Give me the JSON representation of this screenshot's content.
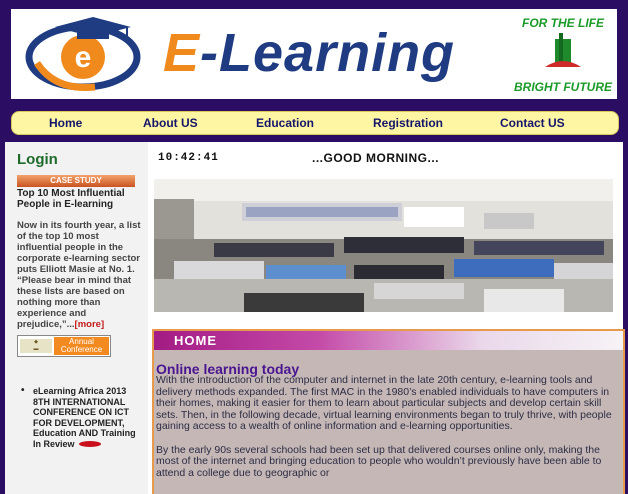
{
  "header": {
    "logo_letter": "e",
    "logo_e": "E",
    "logo_rest": "-Learning",
    "badge_top": "FOR THE LIFE",
    "badge_bottom": "BRIGHT FUTURE"
  },
  "nav": {
    "items": [
      {
        "label": "Home"
      },
      {
        "label": "About US"
      },
      {
        "label": "Education"
      },
      {
        "label": "Registration"
      },
      {
        "label": "Contact US"
      }
    ]
  },
  "sidebar": {
    "login_heading": "Login",
    "case_study_label": "CASE STUDY",
    "case_title": "Top 10 Most Influential People in E-learning",
    "case_body": "Now in its fourth year, a list of the top 10 most influential people in the corporate e-learning sector puts Elliott Masie at No. 1. “Please bear in mind that these lists are based on nothing more than experience and prejudice,”...",
    "more_link": "[more]",
    "conference_line1": "Annual",
    "conference_line2": "Conference",
    "news_items": [
      {
        "text": "eLearning Africa 2013 8TH INTERNATIONAL CONFERENCE ON ICT FOR DEVELOPMENT, Education AND Training In Review"
      }
    ]
  },
  "main": {
    "clock": "10:42:41",
    "greeting": "...GOOD MORNING...",
    "section_title": "HOME",
    "article_title": "Online learning today",
    "paragraphs": [
      "With the introduction of the computer and internet in the late 20th century, e-learning tools and delivery methods expanded. The first MAC in the 1980’s enabled individuals to have computers in their homes, making it easier for them to learn about particular subjects and develop certain skill sets. Then, in the following decade, virtual learning environments began to truly thrive, with people gaining access to a wealth of online information and e-learning opportunities.",
      "By the early 90s several schools had been set up that delivered courses online only, making the most of the internet and bringing education to people who wouldn’t previously have been able to attend a college due to geographic or"
    ]
  },
  "colors": {
    "frame": "#2b0e63",
    "nav_bg": "#fff6a3",
    "nav_text": "#14146b",
    "login_green": "#1e6b2c",
    "home_magenta": "#a31b84",
    "article_title": "#4a1590",
    "content_bg": "#c4b7b6",
    "logo_orange": "#f08a1c",
    "logo_blue": "#1f3c82"
  },
  "icons": {
    "logo": "graduation-cap-e-icon",
    "badge": "open-book-tree-icon",
    "bullet": "bullet-icon",
    "review_marker": "red-oval-icon"
  }
}
